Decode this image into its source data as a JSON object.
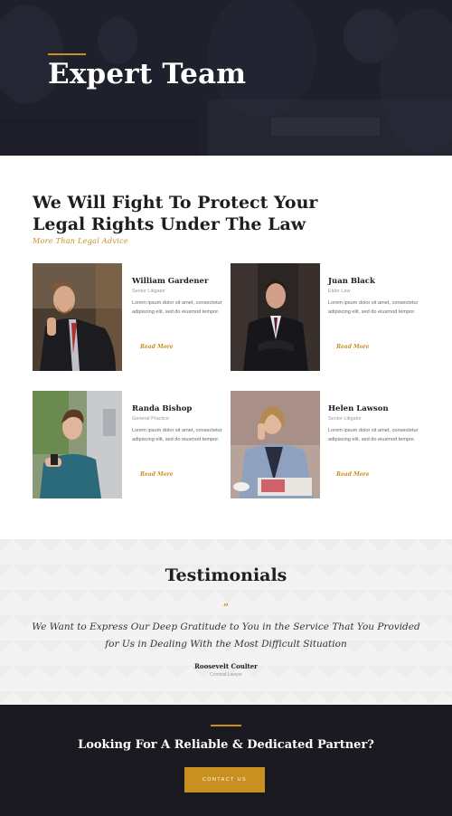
{
  "hero": {
    "title": "Expert Team"
  },
  "intro": {
    "title": "We Will Fight To Protect Your Legal Rights Under The Law",
    "subtitle": "More Than Legal Advice"
  },
  "team": [
    {
      "name": "William Gardener",
      "role": "Senior Litigator",
      "bio": "Lorem ipsum dolor sit amet, consectetur adipiscing elit, sed do eiusmod tempor.",
      "link": "Read More"
    },
    {
      "name": "Juan Black",
      "role": "Elder Law",
      "bio": "Lorem ipsum dolor sit amet, consectetur adipiscing elit, sed do eiusmod tempor.",
      "link": "Read More"
    },
    {
      "name": "Randa Bishop",
      "role": "General Practice",
      "bio": "Lorem ipsum dolor sit amet, consectetur adipiscing elit, sed do eiusmod tempor.",
      "link": "Read More"
    },
    {
      "name": "Helen Lawson",
      "role": "Senior Litigator",
      "bio": "Lorem ipsum dolor sit amet, consectetur adipiscing elit, sed do eiusmod tempor.",
      "link": "Read More"
    }
  ],
  "testimonials": {
    "title": "Testimonials",
    "quote_mark": "”",
    "quote": "We Want to Express Our Deep Gratitude to You in the Service That You Provided for Us in Dealing With the Most Difficult Situation",
    "author": "Roosevelt Coulter",
    "author_role": "Criminal Lawyer"
  },
  "cta": {
    "title": "Looking For A Reliable & Dedicated Partner?",
    "button": "CONTACT US"
  },
  "colors": {
    "accent": "#c8901e",
    "dark": "#1b1a21",
    "hero": "#1f212c",
    "light_bg": "#f3f3f3"
  }
}
